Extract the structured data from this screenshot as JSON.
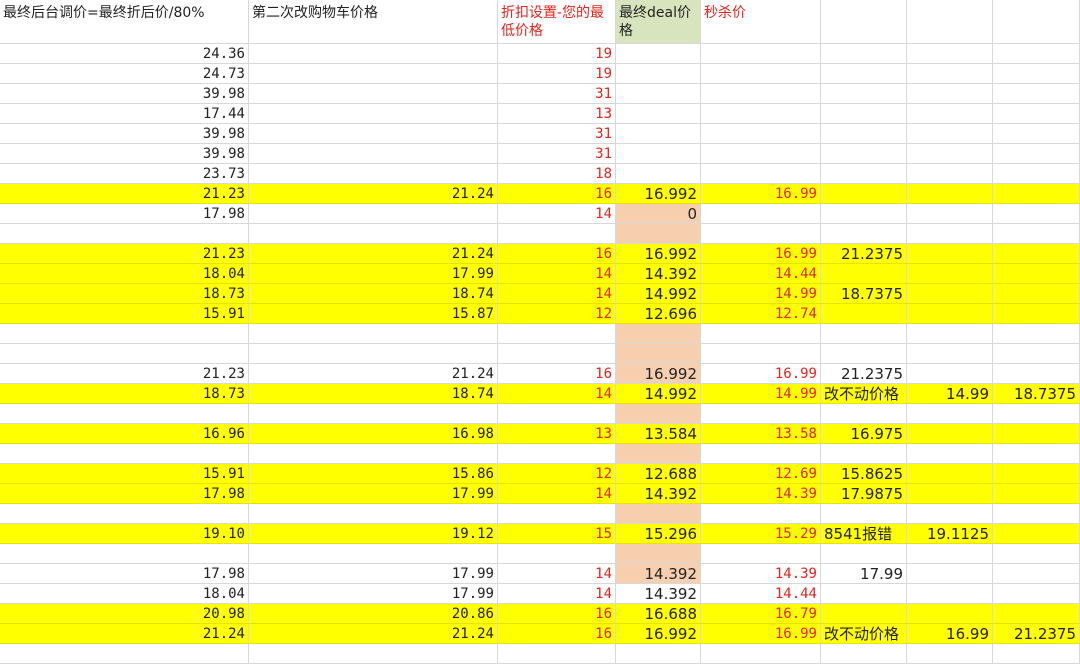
{
  "headers": [
    {
      "text": "最终后台调价=最终折后价/80%",
      "color": "black"
    },
    {
      "text": "第二次改购物车价格",
      "color": "black"
    },
    {
      "text": "折扣设置-您的最低价格",
      "color": "red"
    },
    {
      "text": "最终deal价格",
      "color": "black"
    },
    {
      "text": "秒杀价",
      "color": "red"
    },
    {
      "text": "",
      "color": "black"
    },
    {
      "text": "",
      "color": "black"
    },
    {
      "text": "",
      "color": "black"
    }
  ],
  "colors": {
    "highlight": "#ffff00",
    "peach": "#f8cfae",
    "header_green": "#d7e4bd",
    "red_text": "#e8221c"
  },
  "rows": [
    {
      "hl": false,
      "peach": false,
      "cells": [
        "24.36",
        "",
        "19",
        "",
        "",
        "",
        "",
        ""
      ]
    },
    {
      "hl": false,
      "peach": false,
      "cells": [
        "24.73",
        "",
        "19",
        "",
        "",
        "",
        "",
        ""
      ]
    },
    {
      "hl": false,
      "peach": false,
      "cells": [
        "39.98",
        "",
        "31",
        "",
        "",
        "",
        "",
        ""
      ]
    },
    {
      "hl": false,
      "peach": false,
      "cells": [
        "17.44",
        "",
        "13",
        "",
        "",
        "",
        "",
        ""
      ]
    },
    {
      "hl": false,
      "peach": false,
      "cells": [
        "39.98",
        "",
        "31",
        "",
        "",
        "",
        "",
        ""
      ]
    },
    {
      "hl": false,
      "peach": false,
      "cells": [
        "39.98",
        "",
        "31",
        "",
        "",
        "",
        "",
        ""
      ]
    },
    {
      "hl": false,
      "peach": false,
      "cells": [
        "23.73",
        "",
        "18",
        "",
        "",
        "",
        "",
        ""
      ]
    },
    {
      "hl": true,
      "peach": false,
      "cells": [
        "21.23",
        "21.24",
        "16",
        "16.992",
        "16.99",
        "",
        "",
        ""
      ]
    },
    {
      "hl": false,
      "peach": true,
      "cells": [
        "17.98",
        "",
        "14",
        "0",
        "",
        "",
        "",
        ""
      ]
    },
    {
      "hl": false,
      "peach": true,
      "cells": [
        "",
        "",
        "",
        "",
        "",
        "",
        "",
        ""
      ]
    },
    {
      "hl": true,
      "peach": false,
      "cells": [
        "21.23",
        "21.24",
        "16",
        "16.992",
        "16.99",
        "21.2375",
        "",
        ""
      ]
    },
    {
      "hl": true,
      "peach": false,
      "cells": [
        "18.04",
        "17.99",
        "14",
        "14.392",
        "14.44",
        "",
        "",
        ""
      ]
    },
    {
      "hl": true,
      "peach": false,
      "cells": [
        "18.73",
        "18.74",
        "14",
        "14.992",
        "14.99",
        "18.7375",
        "",
        ""
      ]
    },
    {
      "hl": true,
      "peach": false,
      "cells": [
        "15.91",
        "15.87",
        "12",
        "12.696",
        "12.74",
        "",
        "",
        ""
      ]
    },
    {
      "hl": false,
      "peach": true,
      "cells": [
        "",
        "",
        "",
        "",
        "",
        "",
        "",
        ""
      ]
    },
    {
      "hl": false,
      "peach": true,
      "cells": [
        "",
        "",
        "",
        "",
        "",
        "",
        "",
        ""
      ]
    },
    {
      "hl": false,
      "peach": true,
      "cells": [
        "21.23",
        "21.24",
        "16",
        "16.992",
        "16.99",
        "21.2375",
        "",
        ""
      ]
    },
    {
      "hl": true,
      "peach": false,
      "cells": [
        "18.73",
        "18.74",
        "14",
        "14.992",
        "14.99",
        "改不动价格",
        "14.99",
        "18.7375"
      ]
    },
    {
      "hl": false,
      "peach": true,
      "cells": [
        "",
        "",
        "",
        "",
        "",
        "",
        "",
        ""
      ]
    },
    {
      "hl": true,
      "peach": false,
      "cells": [
        "16.96",
        "16.98",
        "13",
        "13.584",
        "13.58",
        "16.975",
        "",
        ""
      ]
    },
    {
      "hl": false,
      "peach": true,
      "cells": [
        "",
        "",
        "",
        "",
        "",
        "",
        "",
        ""
      ]
    },
    {
      "hl": true,
      "peach": false,
      "cells": [
        "15.91",
        "15.86",
        "12",
        "12.688",
        "12.69",
        "15.8625",
        "",
        ""
      ]
    },
    {
      "hl": true,
      "peach": false,
      "cells": [
        "17.98",
        "17.99",
        "14",
        "14.392",
        "14.39",
        "17.9875",
        "",
        ""
      ]
    },
    {
      "hl": false,
      "peach": true,
      "cells": [
        "",
        "",
        "",
        "",
        "",
        "",
        "",
        ""
      ]
    },
    {
      "hl": true,
      "peach": false,
      "cells": [
        "19.10",
        "19.12",
        "15",
        "15.296",
        "15.29",
        "8541报错",
        "19.1125",
        ""
      ]
    },
    {
      "hl": false,
      "peach": true,
      "cells": [
        "",
        "",
        "",
        "",
        "",
        "",
        "",
        ""
      ]
    },
    {
      "hl": false,
      "peach": true,
      "cells": [
        "17.98",
        "17.99",
        "14",
        "14.392",
        "14.39",
        "17.99",
        "",
        ""
      ]
    },
    {
      "hl": false,
      "peach": false,
      "cells": [
        "18.04",
        "17.99",
        "14",
        "14.392",
        "14.44",
        "",
        "",
        ""
      ]
    },
    {
      "hl": true,
      "peach": false,
      "cells": [
        "20.98",
        "20.86",
        "16",
        "16.688",
        "16.79",
        "",
        "",
        ""
      ]
    },
    {
      "hl": true,
      "peach": false,
      "cells": [
        "21.24",
        "21.24",
        "16",
        "16.992",
        "16.99",
        "改不动价格",
        "16.99",
        "21.2375"
      ]
    },
    {
      "hl": false,
      "peach": false,
      "cells": [
        "",
        "",
        "",
        "",
        "",
        "",
        "",
        ""
      ]
    }
  ]
}
